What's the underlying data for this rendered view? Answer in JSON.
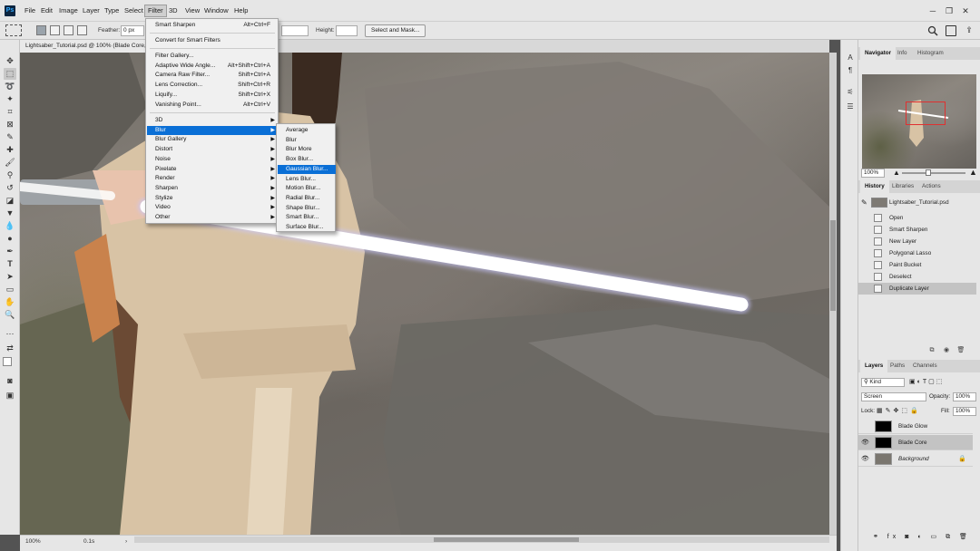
{
  "app": {
    "logo": "Ps"
  },
  "menubar": {
    "items": [
      "File",
      "Edit",
      "Image",
      "Layer",
      "Type",
      "Select",
      "Filter",
      "3D",
      "View",
      "Window",
      "Help"
    ],
    "active": "Filter"
  },
  "window_controls": {
    "minimize": "─",
    "restore": "❐",
    "close": "✕"
  },
  "options_bar": {
    "feather_label": "Feather:",
    "feather_value": "0 px",
    "height_label": "Height:",
    "select_mask_button": "Select and Mask...",
    "search_icon": "search-icon",
    "workspace_icon": "workspace-icon",
    "share_icon": "share-icon"
  },
  "document": {
    "tab_title": "Lightsaber_Tutorial.psd @ 100% (Blade Core, RGB/8) *"
  },
  "statusbar": {
    "zoom": "100%",
    "info": "0.1s"
  },
  "filter_menu": {
    "items": [
      {
        "label": "Smart Sharpen",
        "shortcut": "Alt+Ctrl+F"
      },
      {
        "label": "Convert for Smart Filters",
        "shortcut": ""
      },
      {
        "label": "Filter Gallery...",
        "shortcut": ""
      },
      {
        "label": "Adaptive Wide Angle...",
        "shortcut": "Alt+Shift+Ctrl+A"
      },
      {
        "label": "Camera Raw Filter...",
        "shortcut": "Shift+Ctrl+A"
      },
      {
        "label": "Lens Correction...",
        "shortcut": "Shift+Ctrl+R"
      },
      {
        "label": "Liquify...",
        "shortcut": "Shift+Ctrl+X"
      },
      {
        "label": "Vanishing Point...",
        "shortcut": "Alt+Ctrl+V"
      },
      {
        "label": "3D",
        "shortcut": ""
      },
      {
        "label": "Blur",
        "shortcut": ""
      },
      {
        "label": "Blur Gallery",
        "shortcut": ""
      },
      {
        "label": "Distort",
        "shortcut": ""
      },
      {
        "label": "Noise",
        "shortcut": ""
      },
      {
        "label": "Pixelate",
        "shortcut": ""
      },
      {
        "label": "Render",
        "shortcut": ""
      },
      {
        "label": "Sharpen",
        "shortcut": ""
      },
      {
        "label": "Stylize",
        "shortcut": ""
      },
      {
        "label": "Video",
        "shortcut": ""
      },
      {
        "label": "Other",
        "shortcut": ""
      }
    ],
    "highlighted": "Blur"
  },
  "blur_submenu": {
    "items": [
      "Average",
      "Blur",
      "Blur More",
      "Box Blur...",
      "Gaussian Blur...",
      "Lens Blur...",
      "Motion Blur...",
      "Radial Blur...",
      "Shape Blur...",
      "Smart Blur...",
      "Surface Blur..."
    ],
    "highlighted": "Gaussian Blur..."
  },
  "navigator": {
    "tabs": [
      "Navigator",
      "Info",
      "Histogram"
    ],
    "zoom": "100%"
  },
  "history": {
    "tabs": [
      "History",
      "Libraries",
      "Actions"
    ],
    "snapshot": "Lightsaber_Tutorial.psd",
    "states": [
      "Open",
      "Smart Sharpen",
      "New Layer",
      "Polygonal Lasso",
      "Paint Bucket",
      "Deselect",
      "Duplicate Layer"
    ],
    "selected": "Duplicate Layer"
  },
  "layers": {
    "tabs": [
      "Layers",
      "Paths",
      "Channels"
    ],
    "filter_kind": "Kind",
    "blend_mode": "Screen",
    "opacity_label": "Opacity:",
    "opacity": "100%",
    "lock_label": "Lock:",
    "fill_label": "Fill:",
    "fill": "100%",
    "items": [
      {
        "name": "Blade Glow",
        "visible": false,
        "selected": false
      },
      {
        "name": "Blade Core",
        "visible": true,
        "selected": true
      },
      {
        "name": "Background",
        "visible": true,
        "selected": false
      }
    ]
  },
  "colors": {
    "accent": "#0a6fd6",
    "canvas_bg": "#535353",
    "blade": "#ffffff",
    "robe": "#d8c3a5"
  }
}
